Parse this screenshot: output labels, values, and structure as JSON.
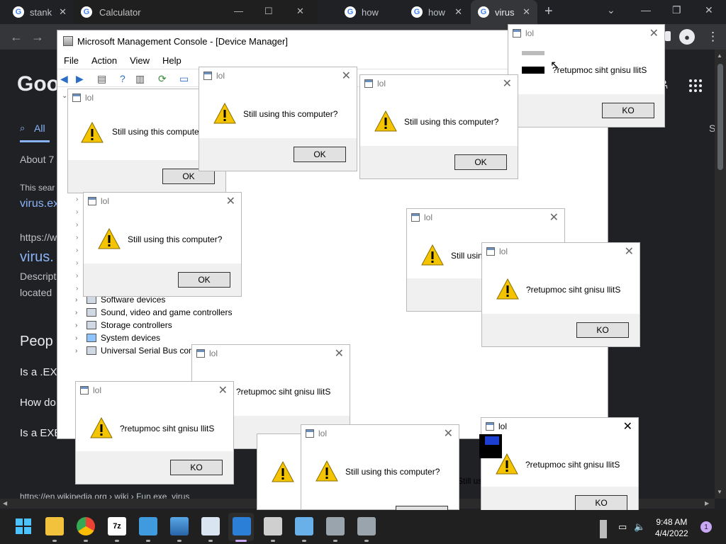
{
  "chrome": {
    "tabs": [
      {
        "title": "stank"
      },
      {
        "title": "how"
      },
      {
        "title": "how"
      },
      {
        "title": "virus"
      }
    ],
    "new_tab_glyph": "+",
    "window_controls": [
      "⌄",
      "—",
      "❐",
      "✕"
    ]
  },
  "calculator": {
    "title": "Calculator",
    "controls": [
      "—",
      "☐",
      "✕"
    ]
  },
  "google": {
    "logo_fragment": "Goo",
    "tab_all": "All",
    "tab_right_fragment": "S",
    "results_count": "About 7",
    "snippet_prefix": "This sear",
    "link_1": "virus.ex",
    "url_fragment": "https://w",
    "link_2": "virus.",
    "desc_1": "Descript",
    "desc_2": "located",
    "people_heading": "Peop",
    "question_1": "Is a .EX",
    "question_2": "How do",
    "question_3": "Is a EXE fil",
    "wiki_line": "https://en.wikipedia.org › wiki › Fun.exe_virus"
  },
  "mmc": {
    "title": "Microsoft Management Console - [Device Manager]",
    "menu": [
      "File",
      "Action",
      "View",
      "Help"
    ],
    "tree": [
      {
        "label": "Software devices"
      },
      {
        "label": "Sound, video and game controllers"
      },
      {
        "label": "Storage controllers"
      },
      {
        "label": "System devices"
      },
      {
        "label": "Universal Serial Bus cont"
      }
    ]
  },
  "dialogs": {
    "title": "lol",
    "message": "Still using this computer?",
    "message_reversed": "?retupmoc siht gnisu llitS",
    "message_cut_1": "Still using this computer",
    "message_cut_2": "Still usin",
    "message_cut_3": "Still us",
    "ok": "OK",
    "ok_reversed": "KO"
  },
  "taskbar": {
    "apps": [
      "start-icon",
      "file-explorer-icon",
      "chrome-icon",
      "7zip-icon",
      "notepad-icon",
      "photos-icon",
      "image-viewer-icon",
      "active-app-icon",
      "calculator-icon",
      "control-panel-icon",
      "network-icon",
      "network-icon"
    ],
    "seven_zip_label": "7z",
    "time": "9:48 AM",
    "date": "4/4/2022",
    "notification_count": "1"
  },
  "colors": {
    "chrome_bg": "#202124",
    "link": "#8ab4f8",
    "taskbar": "#202020",
    "warning": "#f5c400"
  }
}
